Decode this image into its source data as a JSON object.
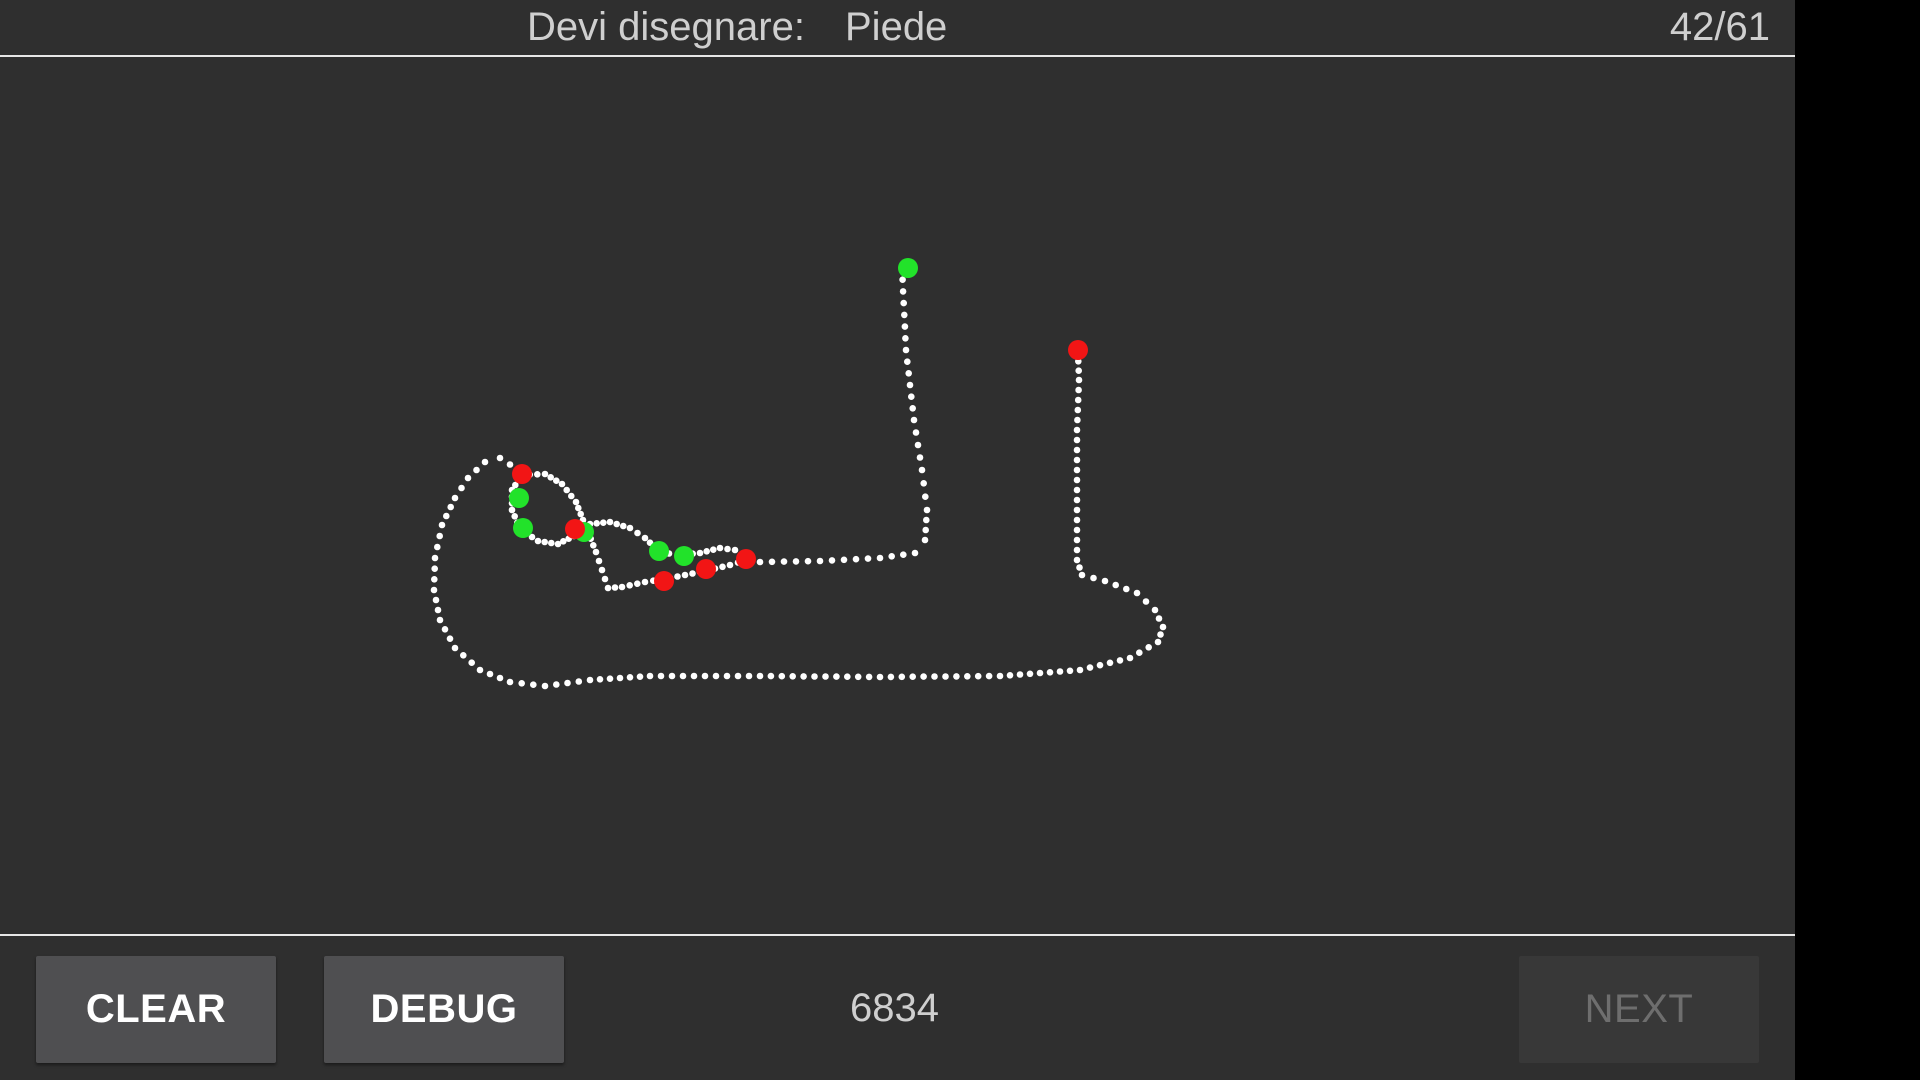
{
  "header": {
    "prompt_label": "Devi disegnare:",
    "prompt_word": "Piede",
    "progress": "42/61"
  },
  "footer": {
    "clear_label": "CLEAR",
    "debug_label": "DEBUG",
    "score": "6834",
    "next_label": "NEXT",
    "next_enabled": false
  },
  "colors": {
    "background": "#2f2f2f",
    "stroke_points": "#ffffff",
    "start_marker": "#22e22a",
    "end_marker": "#f21515"
  }
}
